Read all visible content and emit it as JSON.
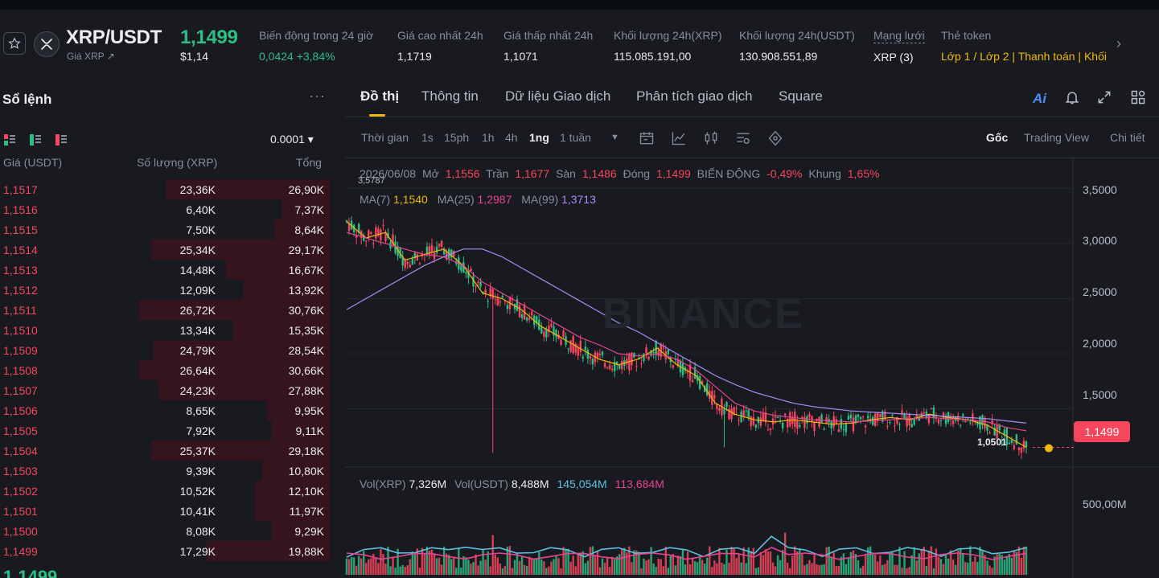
{
  "header": {
    "pair": "XRP/USDT",
    "sub_label": "Giá XRP ↗",
    "last_price": "1,1499",
    "last_price_usd": "$1,14",
    "stats": [
      {
        "label": "Biến động trong 24 giờ",
        "value": "0,0424 +3,84%",
        "color": "green"
      },
      {
        "label": "Giá cao nhất 24h",
        "value": "1,1719",
        "color": "white"
      },
      {
        "label": "Giá thấp nhất 24h",
        "value": "1,1071",
        "color": "white"
      },
      {
        "label": "Khối lượng 24h(XRP)",
        "value": "115.085.191,00",
        "color": "white"
      },
      {
        "label": "Khối lượng 24h(USDT)",
        "value": "130.908.551,89",
        "color": "white"
      },
      {
        "label": "Mạng lưới",
        "value": "XRP (3)",
        "color": "white"
      },
      {
        "label": "Thẻ token",
        "value": "Lớp 1 / Lớp 2 | Thanh toán | Khối l",
        "color": "yellow"
      }
    ]
  },
  "orderbook": {
    "title": "Sổ lệnh",
    "more": "···",
    "precision": "0.0001 ▾",
    "col_price": "Giá (USDT)",
    "col_qty": "Số lượng (XRP)",
    "col_total": "Tổng",
    "rows": [
      {
        "price": "1,1517",
        "qty": "23,36K",
        "total": "26,90K",
        "depth": 0.68
      },
      {
        "price": "1,1516",
        "qty": "6,40K",
        "total": "7,37K",
        "depth": 0.2
      },
      {
        "price": "1,1515",
        "qty": "7,50K",
        "total": "8,64K",
        "depth": 0.23
      },
      {
        "price": "1,1514",
        "qty": "25,34K",
        "total": "29,17K",
        "depth": 0.74
      },
      {
        "price": "1,1513",
        "qty": "14,48K",
        "total": "16,67K",
        "depth": 0.43
      },
      {
        "price": "1,1512",
        "qty": "12,09K",
        "total": "13,92K",
        "depth": 0.36
      },
      {
        "price": "1,1511",
        "qty": "26,72K",
        "total": "30,76K",
        "depth": 0.79
      },
      {
        "price": "1,1510",
        "qty": "13,34K",
        "total": "15,35K",
        "depth": 0.4
      },
      {
        "price": "1,1509",
        "qty": "24,79K",
        "total": "28,54K",
        "depth": 0.73
      },
      {
        "price": "1,1508",
        "qty": "26,64K",
        "total": "30,66K",
        "depth": 0.79
      },
      {
        "price": "1,1507",
        "qty": "24,23K",
        "total": "27,88K",
        "depth": 0.71
      },
      {
        "price": "1,1506",
        "qty": "8,65K",
        "total": "9,95K",
        "depth": 0.26
      },
      {
        "price": "1,1505",
        "qty": "7,92K",
        "total": "9,11K",
        "depth": 0.24
      },
      {
        "price": "1,1504",
        "qty": "25,37K",
        "total": "29,18K",
        "depth": 0.74
      },
      {
        "price": "1,1503",
        "qty": "9,39K",
        "total": "10,80K",
        "depth": 0.28
      },
      {
        "price": "1,1502",
        "qty": "10,52K",
        "total": "12,10K",
        "depth": 0.31
      },
      {
        "price": "1,1501",
        "qty": "10,41K",
        "total": "11,97K",
        "depth": 0.31
      },
      {
        "price": "1,1500",
        "qty": "8,08K",
        "total": "9,29K",
        "depth": 0.24
      },
      {
        "price": "1,1499",
        "qty": "17,29K",
        "total": "19,88K",
        "depth": 0.51
      }
    ],
    "bottom_price": "1,1499"
  },
  "chart_panel": {
    "tabs": [
      "Đồ thị",
      "Thông tin",
      "Dữ liệu Giao dịch",
      "Phân tích giao dịch",
      "Square"
    ],
    "ai_label": "Ai",
    "toolbar": {
      "time_label": "Thời gian",
      "intervals": [
        "1s",
        "15ph",
        "1h",
        "4h",
        "1ng",
        "1 tuần"
      ],
      "active_interval": "1ng",
      "views": [
        "Gốc",
        "Trading View",
        "Chi tiết"
      ],
      "active_view": "Gốc"
    },
    "ohlc": {
      "date": "2026/06/08",
      "open_label": "Mở",
      "open": "1,1556",
      "high_label": "Trần",
      "high": "1,1677",
      "low_label": "Sàn",
      "low": "1,1486",
      "close_label": "Đóng",
      "close": "1,1499",
      "change_label": "BIẾN ĐỘNG",
      "change": "-0,49%",
      "range_label": "Khung",
      "range": "1,65%"
    },
    "ma": {
      "ma7_label": "MA(7)",
      "ma7": "1,1540",
      "ma25_label": "MA(25)",
      "ma25": "1,2987",
      "ma99_label": "MA(99)",
      "ma99": "1,3713"
    },
    "vol": {
      "xrp_label": "Vol(XRP)",
      "xrp": "7,326M",
      "usdt_label": "Vol(USDT)",
      "usdt": "8,488M",
      "ma1": "145,054M",
      "ma2": "113,684M"
    },
    "y_axis_labels": [
      "3,5000",
      "3,0000",
      "2,5000",
      "2,0000",
      "1,5000"
    ],
    "vol_axis_label": "500,00M",
    "current_price_tag": "1,1499",
    "low_marker": "1,0501",
    "high_marker": "3,5787",
    "watermark": "BINANCE",
    "colors": {
      "up": "#2ebd85",
      "down": "#f6465d",
      "ma7": "#f0b90b",
      "ma25": "#e84393",
      "ma99": "#a98cf5",
      "accent": "#f0b90b"
    }
  },
  "chart_data": {
    "type": "line",
    "title": "",
    "xlabel": "",
    "ylabel": "",
    "ylim": [
      1.0,
      3.7
    ],
    "x": [
      0,
      10,
      20,
      30,
      40,
      50,
      60,
      70,
      80,
      90,
      100,
      110,
      120,
      130,
      140,
      150,
      160,
      170,
      180,
      190,
      200,
      210,
      220,
      230,
      240,
      250,
      260,
      270,
      280,
      290,
      300,
      310,
      320,
      330,
      340,
      350
    ],
    "series": [
      {
        "name": "MA(7)",
        "values": [
          3.2,
          3.05,
          3.1,
          2.85,
          2.9,
          2.95,
          2.8,
          2.55,
          2.5,
          2.4,
          2.25,
          2.15,
          2.05,
          1.95,
          1.9,
          1.95,
          2.05,
          1.9,
          1.8,
          1.55,
          1.45,
          1.4,
          1.38,
          1.4,
          1.38,
          1.36,
          1.37,
          1.4,
          1.42,
          1.4,
          1.45,
          1.42,
          1.4,
          1.35,
          1.25,
          1.15
        ]
      },
      {
        "name": "MA(25)",
        "values": [
          3.1,
          3.05,
          3.0,
          2.95,
          2.9,
          2.88,
          2.8,
          2.65,
          2.55,
          2.45,
          2.35,
          2.25,
          2.15,
          2.08,
          2.0,
          1.98,
          2.0,
          1.95,
          1.85,
          1.7,
          1.55,
          1.48,
          1.44,
          1.42,
          1.4,
          1.39,
          1.38,
          1.39,
          1.4,
          1.41,
          1.42,
          1.41,
          1.4,
          1.38,
          1.33,
          1.3
        ]
      },
      {
        "name": "MA(99)",
        "values": [
          2.4,
          2.5,
          2.6,
          2.7,
          2.8,
          2.88,
          2.95,
          2.95,
          2.88,
          2.78,
          2.68,
          2.58,
          2.48,
          2.38,
          2.28,
          2.2,
          2.1,
          2.0,
          1.9,
          1.8,
          1.72,
          1.65,
          1.6,
          1.55,
          1.52,
          1.5,
          1.48,
          1.47,
          1.46,
          1.45,
          1.44,
          1.43,
          1.42,
          1.41,
          1.39,
          1.37
        ]
      }
    ]
  }
}
